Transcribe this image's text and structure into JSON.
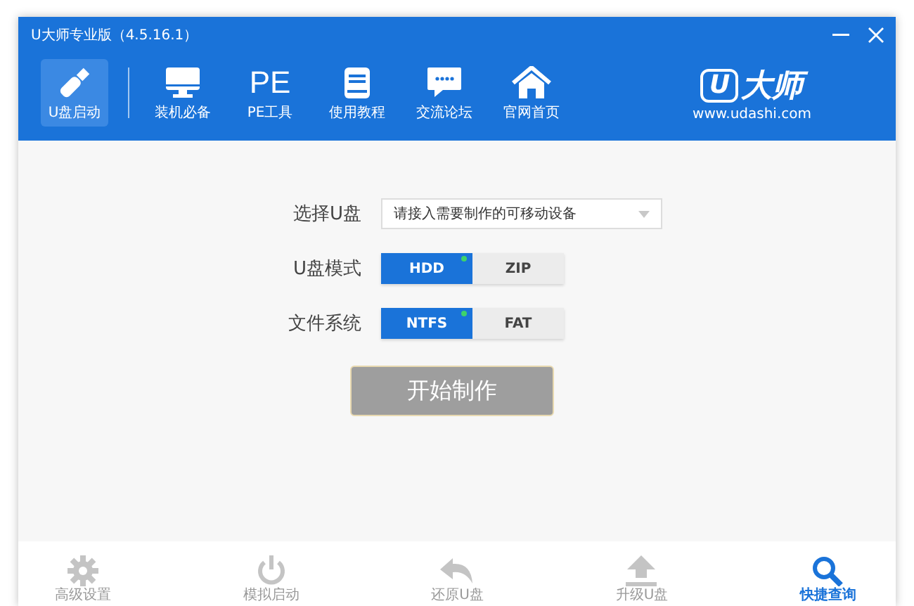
{
  "window": {
    "title": "U大师专业版（4.5.16.1）"
  },
  "nav": {
    "items": [
      {
        "kind": "usb",
        "label": "U盘启动",
        "selected": true
      },
      {
        "kind": "monitor",
        "label": "装机必备",
        "selected": false
      },
      {
        "kind": "text",
        "icon_text": "PE",
        "label": "PE工具",
        "selected": false
      },
      {
        "kind": "book",
        "label": "使用教程",
        "selected": false
      },
      {
        "kind": "chat",
        "label": "交流论坛",
        "selected": false
      },
      {
        "kind": "home",
        "label": "官网首页",
        "selected": false
      }
    ]
  },
  "logo": {
    "mark": "U",
    "name": "大师",
    "url": "www.udashi.com"
  },
  "form": {
    "device": {
      "label": "选择U盘",
      "placeholder": "请接入需要制作的可移动设备"
    },
    "mode": {
      "label": "U盘模式",
      "options": [
        {
          "label": "HDD",
          "selected": true
        },
        {
          "label": "ZIP",
          "selected": false
        }
      ]
    },
    "filesystem": {
      "label": "文件系统",
      "options": [
        {
          "label": "NTFS",
          "selected": true
        },
        {
          "label": "FAT",
          "selected": false
        }
      ]
    },
    "start_button": {
      "label": "开始制作",
      "disabled": true
    }
  },
  "bottom_bar": {
    "items": [
      {
        "kind": "gear",
        "label": "高级设置",
        "selected": false
      },
      {
        "kind": "power",
        "label": "模拟启动",
        "selected": false
      },
      {
        "kind": "undo",
        "label": "还原U盘",
        "selected": false
      },
      {
        "kind": "upload",
        "label": "升级U盘",
        "selected": false
      },
      {
        "kind": "search",
        "label": "快捷查询",
        "selected": true
      }
    ]
  }
}
